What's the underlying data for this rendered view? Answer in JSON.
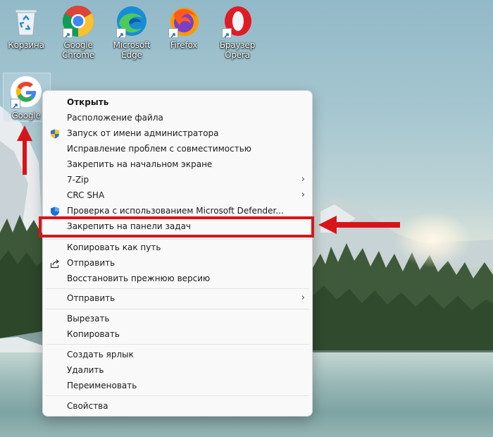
{
  "desktop": {
    "icons": [
      {
        "label": "Корзина",
        "name": "recycle-bin"
      },
      {
        "label": "Google Chrome",
        "name": "chrome"
      },
      {
        "label": "Microsoft Edge",
        "name": "edge"
      },
      {
        "label": "Firefox",
        "name": "firefox"
      },
      {
        "label": "Браузер Opera",
        "name": "opera"
      }
    ],
    "selected_icon": {
      "label": "Google",
      "name": "google"
    }
  },
  "context_menu": {
    "items": [
      {
        "label": "Открыть",
        "bold": true,
        "icon": "",
        "submenu": false
      },
      {
        "label": "Расположение файла",
        "icon": "",
        "submenu": false
      },
      {
        "label": "Запуск от имени администратора",
        "icon": "uac-shield-icon",
        "submenu": false
      },
      {
        "label": "Исправление проблем с совместимостью",
        "icon": "",
        "submenu": false
      },
      {
        "label": "Закрепить на начальном экране",
        "icon": "",
        "submenu": false
      },
      {
        "label": "7-Zip",
        "icon": "",
        "submenu": true
      },
      {
        "label": "CRC SHA",
        "icon": "",
        "submenu": true
      },
      {
        "label": "Проверка с использованием Microsoft Defender...",
        "icon": "defender-icon",
        "submenu": false
      },
      {
        "label": "Закрепить на панели задач",
        "icon": "",
        "submenu": false,
        "highlighted": true
      },
      {
        "label": "Копировать как путь",
        "icon": "",
        "submenu": false
      },
      {
        "label": "Отправить",
        "icon": "share-icon",
        "submenu": false
      },
      {
        "label": "Восстановить прежнюю версию",
        "icon": "",
        "submenu": false
      },
      {
        "label": "Отправить",
        "icon": "",
        "submenu": true
      },
      {
        "label": "Вырезать",
        "icon": "",
        "submenu": false
      },
      {
        "label": "Копировать",
        "icon": "",
        "submenu": false
      },
      {
        "label": "Создать ярлык",
        "icon": "",
        "submenu": false
      },
      {
        "label": "Удалить",
        "icon": "",
        "submenu": false
      },
      {
        "label": "Переименовать",
        "icon": "",
        "submenu": false
      },
      {
        "label": "Свойства",
        "icon": "",
        "submenu": false
      }
    ],
    "submenu_glyph": "›"
  },
  "colors": {
    "annotation_red": "#d8141a",
    "menu_background": "#f9f9f9"
  }
}
